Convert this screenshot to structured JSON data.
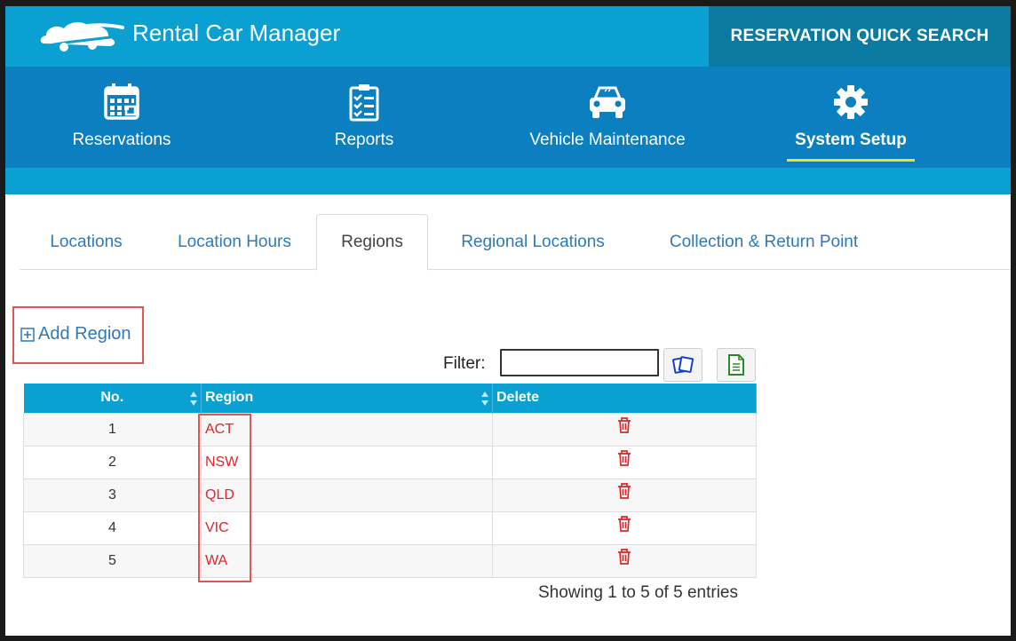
{
  "header": {
    "app_title": "Rental Car Manager",
    "quick_search_label": "RESERVATION QUICK SEARCH"
  },
  "nav": {
    "items": [
      {
        "label": "Reservations",
        "icon": "calendar-icon"
      },
      {
        "label": "Reports",
        "icon": "checklist-icon"
      },
      {
        "label": "Vehicle Maintenance",
        "icon": "car-icon"
      },
      {
        "label": "System Setup",
        "icon": "gear-icon",
        "active": true
      }
    ]
  },
  "tabs": [
    {
      "label": "Locations"
    },
    {
      "label": "Location Hours"
    },
    {
      "label": "Regions",
      "active": true
    },
    {
      "label": "Regional Locations"
    },
    {
      "label": "Collection & Return Point"
    }
  ],
  "add_region_label": "Add Region",
  "filter": {
    "label": "Filter:",
    "value": ""
  },
  "table": {
    "headers": {
      "no": "No.",
      "region": "Region",
      "delete": "Delete"
    },
    "rows": [
      {
        "no": "1",
        "region": "ACT"
      },
      {
        "no": "2",
        "region": "NSW"
      },
      {
        "no": "3",
        "region": "QLD"
      },
      {
        "no": "4",
        "region": "VIC"
      },
      {
        "no": "5",
        "region": "WA"
      }
    ]
  },
  "showing_text": "Showing 1 to 5 of 5 entries",
  "colors": {
    "topbar": "#0aa0d2",
    "mainnav": "#0b7fc0",
    "quick_search_bg": "#0a7aa0",
    "link": "#2f79b9",
    "region_text": "#e0252a",
    "highlight_box": "#e05555",
    "active_underline": "#f0e020"
  }
}
